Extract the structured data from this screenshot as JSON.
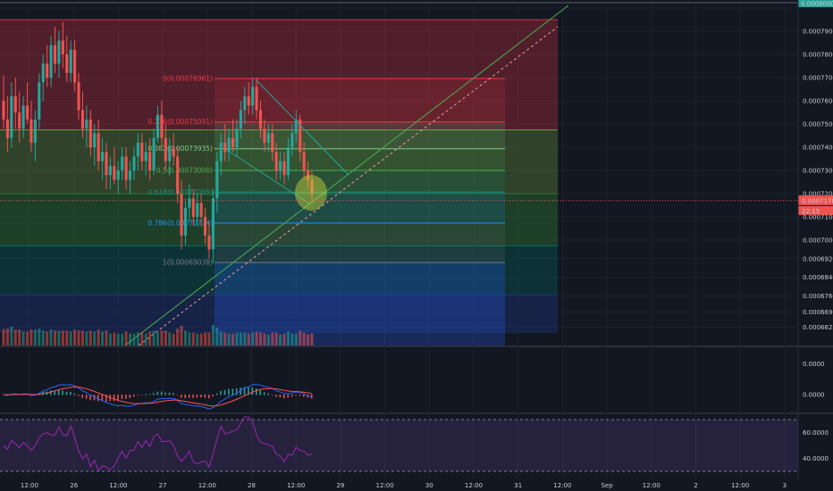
{
  "chart_data": {
    "type": "candlestick",
    "title": "",
    "price_axis": {
      "ticks": [
        0.0008,
        0.00079,
        0.00078,
        0.00077,
        0.00076,
        0.00075,
        0.00074,
        0.00073,
        0.00072,
        0.00071,
        0.0007,
        0.000692,
        0.000684,
        0.000676,
        0.000669,
        0.0006625
      ],
      "tick_labels": [
        "0.000800000",
        "0.00079000",
        "0.00078000",
        "0.00077000",
        "0.00076000",
        "0.00075000",
        "0.00074000",
        "0.00073000",
        "0.00072000",
        "0.00071000",
        "0.00070000",
        "0.00069200",
        "0.00068400",
        "0.00067600",
        "0.00066900",
        "0.00066250"
      ],
      "top_badge": "0.000800000",
      "current_price_label": "0.00071700",
      "current_price_sublabel": "22:15"
    },
    "time_axis": {
      "labels": [
        "12:00",
        "26",
        "12:00",
        "27",
        "12:00",
        "28",
        "12:00",
        "29",
        "12:00",
        "30",
        "12:00",
        "31",
        "12:00",
        "Sep",
        "12:00",
        "2",
        "12:00",
        "3"
      ]
    },
    "fibonacci": [
      {
        "ratio": "0",
        "price": 0.00076961,
        "label": "0(0.00076961)"
      },
      {
        "ratio": "0.236",
        "price": 0.00075091,
        "label": "0.236(0.00075091)"
      },
      {
        "ratio": "0.382",
        "price": 0.00073935,
        "label": "0.382(0.00073935)"
      },
      {
        "ratio": "0.5",
        "price": 0.00073,
        "label": "0.5(0.00073000)"
      },
      {
        "ratio": "0.618",
        "price": 0.00072065,
        "label": "0.618(0.00072065)"
      },
      {
        "ratio": "0.786",
        "price": 0.00070734,
        "label": "0.786(0.00070734)"
      },
      {
        "ratio": "1",
        "price": 0.00069038,
        "label": "1(0.00069038)"
      }
    ],
    "series": [
      {
        "open": 0.00076,
        "high": 0.000771,
        "low": 0.000748,
        "close": 0.000752
      },
      {
        "open": 0.000752,
        "high": 0.000762,
        "low": 0.000738,
        "close": 0.000744
      },
      {
        "open": 0.000744,
        "high": 0.000768,
        "low": 0.00074,
        "close": 0.000762
      },
      {
        "open": 0.000762,
        "high": 0.00077,
        "low": 0.000748,
        "close": 0.000755
      },
      {
        "open": 0.000755,
        "high": 0.000764,
        "low": 0.000742,
        "close": 0.000748
      },
      {
        "open": 0.000748,
        "high": 0.000762,
        "low": 0.000744,
        "close": 0.000758
      },
      {
        "open": 0.000758,
        "high": 0.000768,
        "low": 0.00075,
        "close": 0.000752
      },
      {
        "open": 0.000752,
        "high": 0.00076,
        "low": 0.000738,
        "close": 0.000742
      },
      {
        "open": 0.000742,
        "high": 0.000756,
        "low": 0.000734,
        "close": 0.000752
      },
      {
        "open": 0.000752,
        "high": 0.000772,
        "low": 0.000748,
        "close": 0.000768
      },
      {
        "open": 0.000768,
        "high": 0.00078,
        "low": 0.00076,
        "close": 0.000776
      },
      {
        "open": 0.000776,
        "high": 0.000784,
        "low": 0.000766,
        "close": 0.00077
      },
      {
        "open": 0.00077,
        "high": 0.000788,
        "low": 0.000766,
        "close": 0.000784
      },
      {
        "open": 0.000784,
        "high": 0.000792,
        "low": 0.000772,
        "close": 0.000776
      },
      {
        "open": 0.000776,
        "high": 0.00079,
        "low": 0.00077,
        "close": 0.000786
      },
      {
        "open": 0.000786,
        "high": 0.000794,
        "low": 0.000774,
        "close": 0.00078
      },
      {
        "open": 0.00078,
        "high": 0.000788,
        "low": 0.000768,
        "close": 0.000772
      },
      {
        "open": 0.000772,
        "high": 0.000786,
        "low": 0.000768,
        "close": 0.000782
      },
      {
        "open": 0.000782,
        "high": 0.000786,
        "low": 0.000764,
        "close": 0.000768
      },
      {
        "open": 0.000768,
        "high": 0.000772,
        "low": 0.000752,
        "close": 0.000756
      },
      {
        "open": 0.000756,
        "high": 0.000764,
        "low": 0.000744,
        "close": 0.000748
      },
      {
        "open": 0.000748,
        "high": 0.000758,
        "low": 0.00074,
        "close": 0.000752
      },
      {
        "open": 0.000752,
        "high": 0.000756,
        "low": 0.000736,
        "close": 0.00074
      },
      {
        "open": 0.00074,
        "high": 0.00075,
        "low": 0.000732,
        "close": 0.000746
      },
      {
        "open": 0.000746,
        "high": 0.000752,
        "low": 0.00073,
        "close": 0.000734
      },
      {
        "open": 0.000734,
        "high": 0.000744,
        "low": 0.000726,
        "close": 0.000738
      },
      {
        "open": 0.000738,
        "high": 0.000742,
        "low": 0.000722,
        "close": 0.000728
      },
      {
        "open": 0.000728,
        "high": 0.000736,
        "low": 0.000722,
        "close": 0.000732
      },
      {
        "open": 0.000732,
        "high": 0.00074,
        "low": 0.000724,
        "close": 0.000726
      },
      {
        "open": 0.000726,
        "high": 0.000734,
        "low": 0.00072,
        "close": 0.00073
      },
      {
        "open": 0.00073,
        "high": 0.00074,
        "low": 0.000726,
        "close": 0.000736
      },
      {
        "open": 0.000736,
        "high": 0.00074,
        "low": 0.000722,
        "close": 0.000726
      },
      {
        "open": 0.000726,
        "high": 0.000734,
        "low": 0.00072,
        "close": 0.00073
      },
      {
        "open": 0.00073,
        "high": 0.00074,
        "low": 0.000726,
        "close": 0.000736
      },
      {
        "open": 0.000736,
        "high": 0.000746,
        "low": 0.00073,
        "close": 0.000742
      },
      {
        "open": 0.000742,
        "high": 0.000746,
        "low": 0.00073,
        "close": 0.000734
      },
      {
        "open": 0.000734,
        "high": 0.000742,
        "low": 0.000728,
        "close": 0.000738
      },
      {
        "open": 0.000738,
        "high": 0.000744,
        "low": 0.000726,
        "close": 0.00073
      },
      {
        "open": 0.00073,
        "high": 0.000748,
        "low": 0.000728,
        "close": 0.000744
      },
      {
        "open": 0.000744,
        "high": 0.000758,
        "low": 0.000742,
        "close": 0.000754
      },
      {
        "open": 0.000754,
        "high": 0.00076,
        "low": 0.00074,
        "close": 0.000744
      },
      {
        "open": 0.000744,
        "high": 0.00075,
        "low": 0.00073,
        "close": 0.000734
      },
      {
        "open": 0.000734,
        "high": 0.000744,
        "low": 0.000728,
        "close": 0.00074
      },
      {
        "open": 0.00074,
        "high": 0.000746,
        "low": 0.000732,
        "close": 0.000736
      },
      {
        "open": 0.000736,
        "high": 0.00074,
        "low": 0.000716,
        "close": 0.00072
      },
      {
        "open": 0.00072,
        "high": 0.000726,
        "low": 0.000696,
        "close": 0.000702
      },
      {
        "open": 0.000702,
        "high": 0.000718,
        "low": 0.000698,
        "close": 0.000714
      },
      {
        "open": 0.000714,
        "high": 0.000724,
        "low": 0.000708,
        "close": 0.000718
      },
      {
        "open": 0.000718,
        "high": 0.000722,
        "low": 0.000706,
        "close": 0.00071
      },
      {
        "open": 0.00071,
        "high": 0.00072,
        "low": 0.000706,
        "close": 0.000716
      },
      {
        "open": 0.000716,
        "high": 0.00072,
        "low": 0.000706,
        "close": 0.00071
      },
      {
        "open": 0.00071,
        "high": 0.000714,
        "low": 0.000698,
        "close": 0.000702
      },
      {
        "open": 0.000702,
        "high": 0.000708,
        "low": 0.000692,
        "close": 0.000696
      },
      {
        "open": 0.000696,
        "high": 0.000722,
        "low": 0.00069,
        "close": 0.000718
      },
      {
        "open": 0.000718,
        "high": 0.000738,
        "low": 0.000712,
        "close": 0.000734
      },
      {
        "open": 0.000734,
        "high": 0.000746,
        "low": 0.000728,
        "close": 0.000742
      },
      {
        "open": 0.000742,
        "high": 0.00075,
        "low": 0.000734,
        "close": 0.000738
      },
      {
        "open": 0.000738,
        "high": 0.000748,
        "low": 0.000734,
        "close": 0.000744
      },
      {
        "open": 0.000744,
        "high": 0.000752,
        "low": 0.000738,
        "close": 0.00074
      },
      {
        "open": 0.00074,
        "high": 0.000752,
        "low": 0.000736,
        "close": 0.000748
      },
      {
        "open": 0.000748,
        "high": 0.00076,
        "low": 0.000744,
        "close": 0.000756
      },
      {
        "open": 0.000756,
        "high": 0.000766,
        "low": 0.00075,
        "close": 0.000762
      },
      {
        "open": 0.000762,
        "high": 0.000768,
        "low": 0.000754,
        "close": 0.000758
      },
      {
        "open": 0.000758,
        "high": 0.00077,
        "low": 0.000754,
        "close": 0.000766
      },
      {
        "open": 0.000766,
        "high": 0.00077,
        "low": 0.000752,
        "close": 0.000756
      },
      {
        "open": 0.000756,
        "high": 0.00076,
        "low": 0.000744,
        "close": 0.000748
      },
      {
        "open": 0.000748,
        "high": 0.000752,
        "low": 0.000738,
        "close": 0.000742
      },
      {
        "open": 0.000742,
        "high": 0.00075,
        "low": 0.000738,
        "close": 0.000746
      },
      {
        "open": 0.000746,
        "high": 0.00075,
        "low": 0.000734,
        "close": 0.000738
      },
      {
        "open": 0.000738,
        "high": 0.000742,
        "low": 0.000726,
        "close": 0.00073
      },
      {
        "open": 0.00073,
        "high": 0.000738,
        "low": 0.000726,
        "close": 0.000734
      },
      {
        "open": 0.000734,
        "high": 0.000738,
        "low": 0.000724,
        "close": 0.000728
      },
      {
        "open": 0.000728,
        "high": 0.000744,
        "low": 0.000726,
        "close": 0.00074
      },
      {
        "open": 0.00074,
        "high": 0.00075,
        "low": 0.000736,
        "close": 0.000746
      },
      {
        "open": 0.000746,
        "high": 0.000756,
        "low": 0.000742,
        "close": 0.000752
      },
      {
        "open": 0.000752,
        "high": 0.000754,
        "low": 0.000734,
        "close": 0.000738
      },
      {
        "open": 0.000738,
        "high": 0.000742,
        "low": 0.000726,
        "close": 0.00073
      },
      {
        "open": 0.00073,
        "high": 0.000734,
        "low": 0.000722,
        "close": 0.000726
      },
      {
        "open": 0.000726,
        "high": 0.00073,
        "low": 0.000716,
        "close": 0.00072
      }
    ]
  },
  "colors": {
    "background": "#131722",
    "up": "#26a69a",
    "down": "#ef5350",
    "ma_red": "#ff5252",
    "ma_blue": "#2962ff",
    "rsi_line": "#9c27b0",
    "fib_0_236": "#f23645",
    "fib_0_382": "#81c784",
    "fib_0_5": "#4caf50",
    "fib_0_618": "#089981",
    "fib_0_786": "#2196f3",
    "fib_1": "#787b86"
  },
  "macd_axis": {
    "tick_labels": [
      "0.0000",
      "0.0000"
    ]
  },
  "rsi_axis": {
    "tick_labels": [
      "60.0000",
      "40.0000"
    ]
  }
}
